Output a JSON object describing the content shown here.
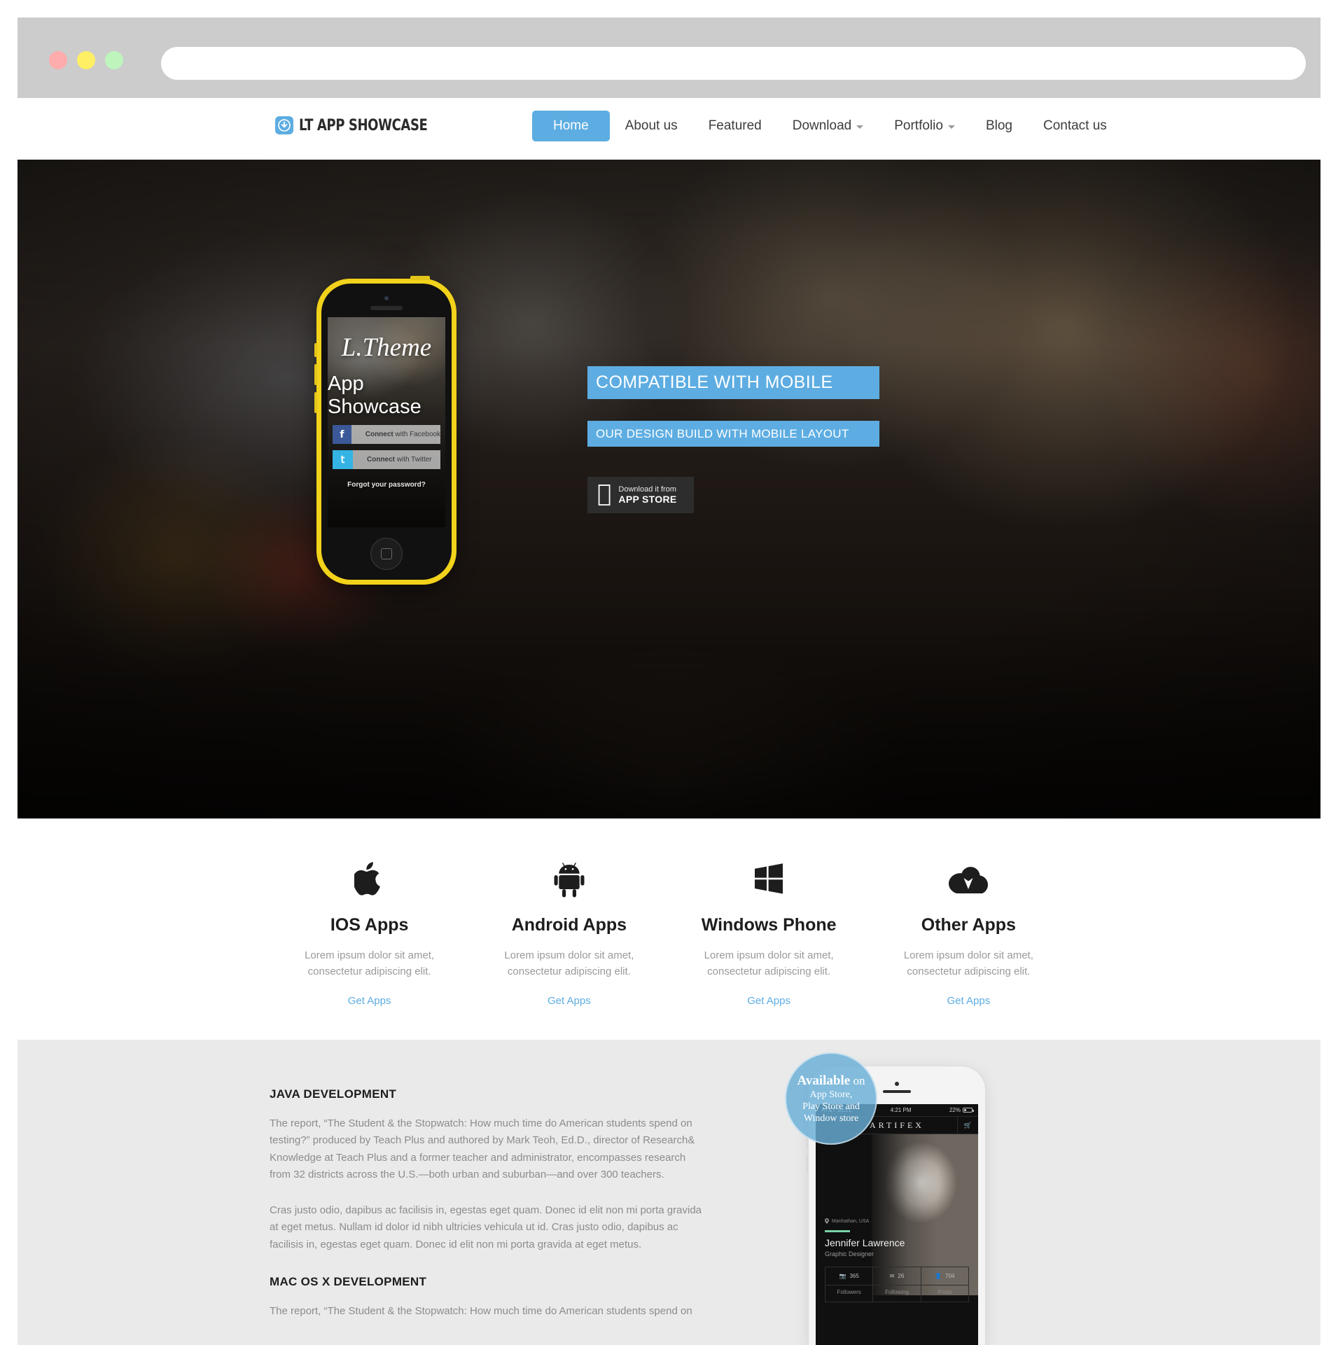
{
  "browser": {
    "url_value": "",
    "url_placeholder": "",
    "dots": [
      "close",
      "minimize",
      "maximize"
    ]
  },
  "header": {
    "brand_text": "LT APP SHOWCASE",
    "brand_icon": "download-circle-icon",
    "nav": [
      {
        "label": "Home",
        "active": true,
        "caret": false
      },
      {
        "label": "About us",
        "active": false,
        "caret": false
      },
      {
        "label": "Featured",
        "active": false,
        "caret": false
      },
      {
        "label": "Download",
        "active": false,
        "caret": true
      },
      {
        "label": "Portfolio",
        "active": false,
        "caret": true
      },
      {
        "label": "Blog",
        "active": false,
        "caret": false
      },
      {
        "label": "Contact us",
        "active": false,
        "caret": false
      }
    ]
  },
  "hero": {
    "band_title": "COMPATIBLE WITH MOBILE",
    "band_sub": "OUR DESIGN BUILD WITH MOBILE LAYOUT",
    "appstore": {
      "icon": "apple-icon",
      "line1": "Download it from",
      "line2": "APP STORE"
    },
    "phone": {
      "logo": "L.Theme",
      "subtitle": "App Showcase",
      "facebook_strong": "Connect",
      "facebook_rest": " with Facebook",
      "facebook_icon": "facebook-icon",
      "twitter_strong": "Connect",
      "twitter_rest": " with Twitter",
      "twitter_icon": "twitter-icon",
      "forgot": "Forgot your password?"
    }
  },
  "features": [
    {
      "icon": "apple-icon",
      "title": "IOS Apps",
      "desc": "Lorem ipsum dolor sit amet, consectetur adipiscing elit.",
      "link": "Get Apps"
    },
    {
      "icon": "android-icon",
      "title": "Android Apps",
      "desc": "Lorem ipsum dolor sit amet, consectetur adipiscing elit.",
      "link": "Get Apps"
    },
    {
      "icon": "windows-icon",
      "title": "Windows Phone",
      "desc": "Lorem ipsum dolor sit amet, consectetur adipiscing elit.",
      "link": "Get Apps"
    },
    {
      "icon": "cloud-upload-icon",
      "title": "Other Apps",
      "desc": "Lorem ipsum dolor sit amet, consectetur adipiscing elit.",
      "link": "Get Apps"
    }
  ],
  "dev_section": {
    "heading_java": "JAVA DEVELOPMENT",
    "para_java_1": "The report, “The Student & the Stopwatch: How much time do American students spend on testing?” produced by Teach Plus and authored by Mark Teoh, Ed.D., director of Research& Knowledge at Teach Plus and a former teacher and administrator, encompasses research from 32 districts across the U.S.—both urban and suburban—and over 300 teachers.",
    "para_java_2": "Cras justo odio, dapibus ac facilisis in, egestas eget quam. Donec id elit non mi porta gravida at eget metus. Nullam id dolor id nibh ultricies vehicula ut id. Cras justo odio, dapibus ac facilisis in, egestas eget quam. Donec id elit non mi porta gravida at eget metus.",
    "heading_mac": "MAC OS X DEVELOPMENT",
    "para_mac_1": "The report, “The Student & the Stopwatch: How much time do American students spend on",
    "badge_line1_strong": "Available",
    "badge_line1_rest": " on",
    "badge_line2": "App Store,",
    "badge_line3": "Play Store and",
    "badge_line4": "Window store",
    "phone": {
      "carrier": "AT&T BELL",
      "time": "4:21 PM",
      "battery": "22%",
      "brand": "ARTIFEX",
      "cart_icon": "cart-icon",
      "location_icon": "pin-icon",
      "location": "Manhathan, USA",
      "name": "Jennifer Lawrence",
      "role": "Graphic Designer",
      "stats": [
        {
          "icon": "camera-icon",
          "value": "365"
        },
        {
          "icon": "envelope-icon",
          "value": "26"
        },
        {
          "icon": "person-icon",
          "value": "704"
        }
      ],
      "tabs": [
        "Followers",
        "Following",
        "Posts"
      ]
    }
  },
  "colors": {
    "accent_blue": "#5dade2",
    "phone_yellow": "#f2d21a",
    "section_gray": "#eaeaea",
    "chrome_gray": "#cccccc",
    "dark_button": "#2d2d2d"
  }
}
